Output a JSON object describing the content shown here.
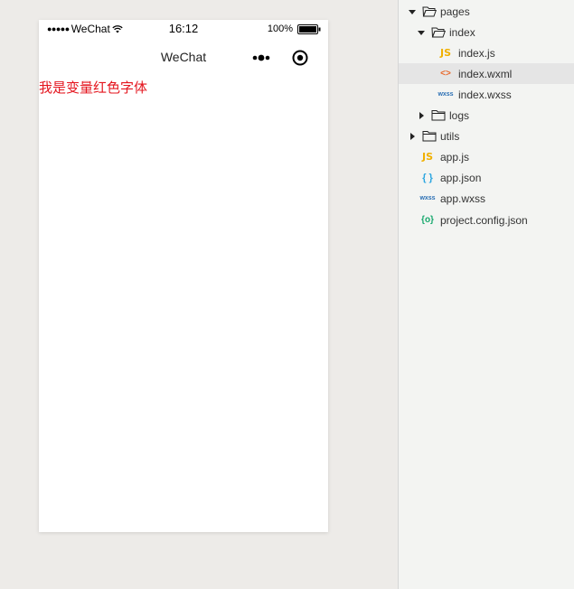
{
  "simulator": {
    "status_bar": {
      "signal": "●●●●●",
      "carrier": "WeChat",
      "time": "16:12",
      "battery": "100%"
    },
    "nav_title": "WeChat",
    "content_text": "我是变量红色字体",
    "content_color": "#e4151e"
  },
  "file_tree": {
    "items": [
      {
        "label": "pages",
        "type": "folder",
        "open": true
      },
      {
        "label": "index",
        "type": "folder",
        "open": true
      },
      {
        "label": "index.js",
        "type": "js",
        "icon": "JS"
      },
      {
        "label": "index.wxml",
        "type": "wxml",
        "icon": "<>",
        "selected": true
      },
      {
        "label": "index.wxss",
        "type": "wxss",
        "icon": "wxss"
      },
      {
        "label": "logs",
        "type": "folder",
        "open": false
      },
      {
        "label": "utils",
        "type": "folder",
        "open": false
      },
      {
        "label": "app.js",
        "type": "js",
        "icon": "JS"
      },
      {
        "label": "app.json",
        "type": "json",
        "icon": "{ }"
      },
      {
        "label": "app.wxss",
        "type": "wxss",
        "icon": "wxss"
      },
      {
        "label": "project.config.json",
        "type": "config",
        "icon": "{o}"
      }
    ]
  }
}
